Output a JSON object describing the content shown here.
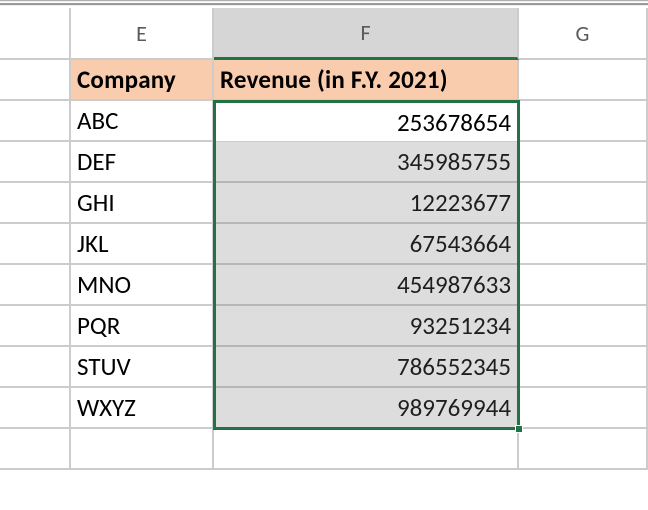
{
  "columns": {
    "E": "E",
    "F": "F",
    "G": "G"
  },
  "headers": {
    "company": "Company",
    "revenue": "Revenue (in F.Y. 2021)"
  },
  "rows": [
    {
      "company": "ABC",
      "revenue": "253678654"
    },
    {
      "company": "DEF",
      "revenue": "345985755"
    },
    {
      "company": "GHI",
      "revenue": "12223677"
    },
    {
      "company": "JKL",
      "revenue": "67543664"
    },
    {
      "company": "MNO",
      "revenue": "454987633"
    },
    {
      "company": "PQR",
      "revenue": "93251234"
    },
    {
      "company": "STUV",
      "revenue": "786552345"
    },
    {
      "company": "WXYZ",
      "revenue": "989769944"
    }
  ],
  "active_cell_value": "253678654"
}
